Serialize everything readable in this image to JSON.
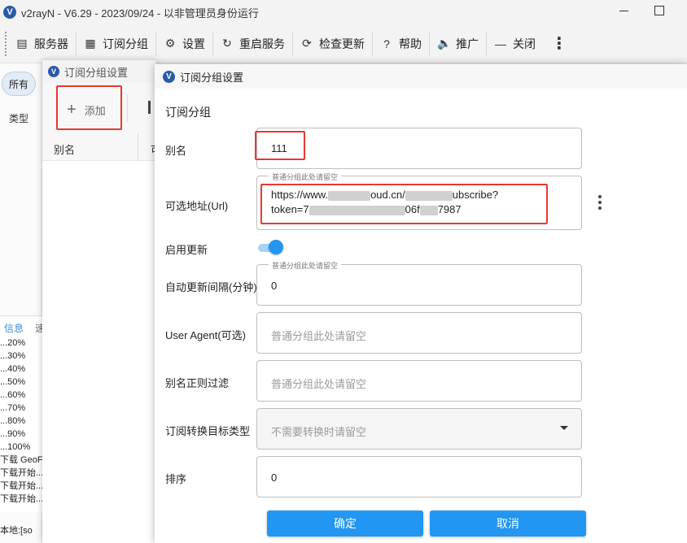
{
  "window": {
    "title": "v2rayN - V6.29 - 2023/09/24 - 以非管理员身份运行",
    "logo_letter": "V"
  },
  "toolbar": {
    "items": [
      {
        "label": "服务器",
        "icon": "server-icon",
        "glyph": "▤"
      },
      {
        "label": "订阅分组",
        "icon": "subscription-icon",
        "glyph": "▦"
      },
      {
        "label": "设置",
        "icon": "gear-icon",
        "glyph": "⚙"
      },
      {
        "label": "重启服务",
        "icon": "restart-icon",
        "glyph": "↻"
      },
      {
        "label": "检查更新",
        "icon": "update-icon",
        "glyph": "⟳"
      },
      {
        "label": "帮助",
        "icon": "help-icon",
        "glyph": "?"
      },
      {
        "label": "推广",
        "icon": "speaker-icon",
        "glyph": "🔈"
      },
      {
        "label": "关闭",
        "icon": "minus-icon",
        "glyph": "—"
      }
    ],
    "more_glyph": "⋮"
  },
  "main": {
    "filter_chip": "所有",
    "column_type": "类型",
    "log_tab_info": "信息",
    "log_tab_other": "速",
    "log_lines": [
      "...20%",
      "...30%",
      "...40%",
      "...50%",
      "...60%",
      "...70%",
      "...80%",
      "...90%",
      "...100%",
      "下载 GeoF",
      "下载开始...",
      "下载开始...",
      "下载开始..."
    ],
    "status_text": "本地:[so"
  },
  "sub_list_dialog": {
    "title": "订阅分组设置",
    "add_label": "添加",
    "add_glyph": "+",
    "column_alias": "别名",
    "column_second": "可"
  },
  "settings_dialog": {
    "title": "订阅分组设置",
    "section": "订阅分组",
    "alias": {
      "label": "别名",
      "value": "111"
    },
    "url": {
      "label": "可选地址(Url)",
      "hint": "普通分组此处请留空",
      "line1_a": "https://www.",
      "line1_b": "oud.cn/",
      "line1_c": "ubscribe?",
      "line2_a": "token=7",
      "line2_b": "06f",
      "line2_c": "7987"
    },
    "auto_update": {
      "label": "启用更新",
      "enabled": true
    },
    "interval": {
      "label": "自动更新间隔(分钟)",
      "hint": "普通分组此处请留空",
      "value": "0"
    },
    "user_agent": {
      "label": "User Agent(可选)",
      "placeholder": "普通分组此处请留空"
    },
    "alias_regex": {
      "label": "别名正则过滤",
      "placeholder": "普通分组此处请留空"
    },
    "convert_target": {
      "label": "订阅转换目标类型",
      "placeholder": "不需要转换时请留空"
    },
    "sort": {
      "label": "排序",
      "value": "0"
    },
    "confirm_label": "确定",
    "cancel_label": "取消"
  },
  "colors": {
    "accent": "#2196f3",
    "highlight": "#e53935"
  }
}
